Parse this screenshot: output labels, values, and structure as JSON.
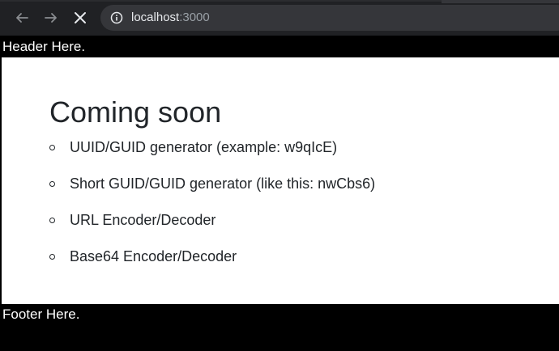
{
  "browser": {
    "url_host": "localhost",
    "url_port": ":3000",
    "icons": {
      "back": "arrow-left-icon",
      "forward": "arrow-right-icon",
      "stop": "close-icon",
      "site_info": "info-icon"
    }
  },
  "page": {
    "header_text": "Header Here.",
    "heading": "Coming soon",
    "items": [
      "UUID/GUID generator (example: w9qIcE)",
      "Short GUID/GUID generator (like this: nwCbs6)",
      "URL Encoder/Decoder",
      "Base64 Encoder/Decoder"
    ],
    "footer_text": "Footer Here."
  },
  "colors": {
    "chrome_bg": "#202124",
    "omnibox_bg": "#35363a",
    "page_bg": "#ffffff",
    "header_footer_bg": "#000000",
    "text": "#212529"
  }
}
